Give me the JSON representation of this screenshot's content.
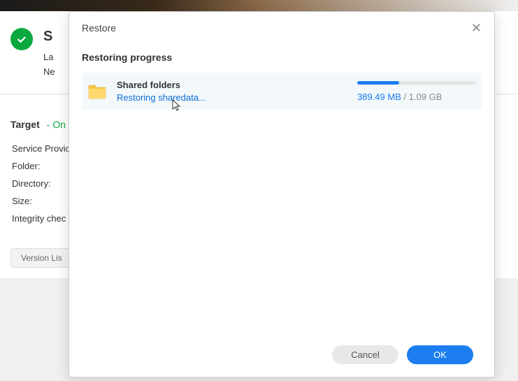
{
  "background": {
    "status": {
      "title_fragment": "S",
      "last_label": "La",
      "next_label": "Ne"
    },
    "target": {
      "header": "Target",
      "online": "- On",
      "rows": {
        "service": "Service Provic",
        "folder": "Folder:",
        "directory": "Directory:",
        "size": "Size:",
        "integrity": "Integrity chec"
      },
      "version_btn": "Version Lis"
    }
  },
  "modal": {
    "title": "Restore",
    "section_title": "Restoring progress",
    "item": {
      "name": "Shared folders",
      "status": "Restoring sharedata...",
      "current": "389.49 MB",
      "separator": " / ",
      "total": "1.09 GB"
    },
    "buttons": {
      "cancel": "Cancel",
      "ok": "OK"
    }
  },
  "chart_data": {
    "type": "progress",
    "percent": 35,
    "current_mb": 389.49,
    "total_gb": 1.09
  }
}
